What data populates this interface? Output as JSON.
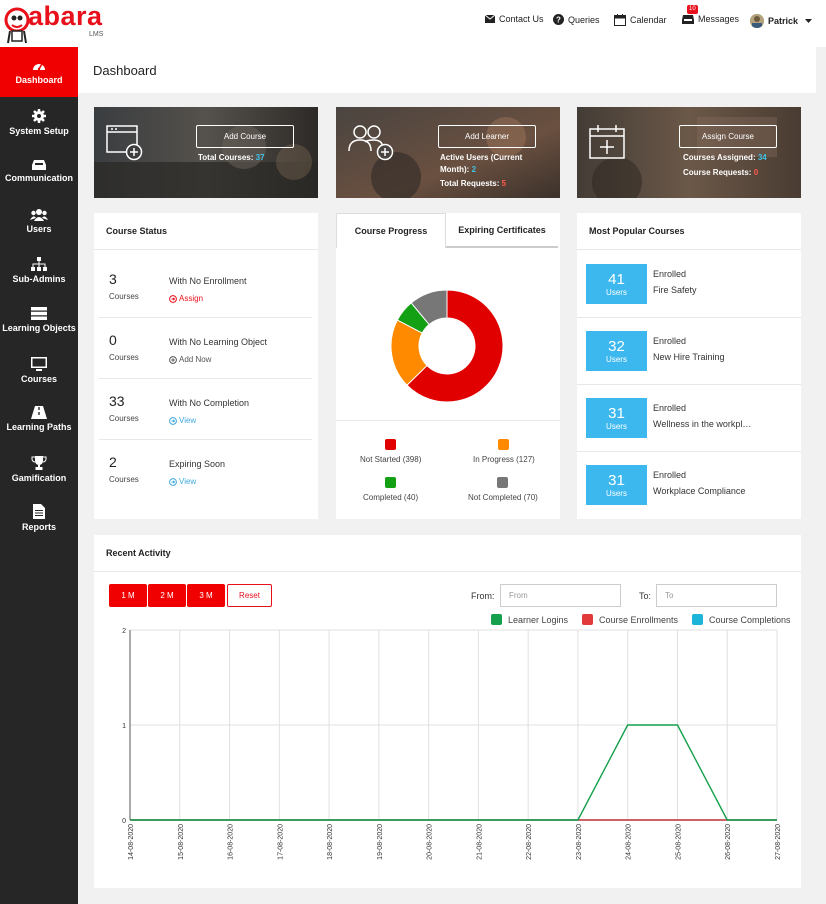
{
  "brand": {
    "name": "abara",
    "sub": "LMS"
  },
  "topnav": {
    "contact": "Contact Us",
    "queries": "Queries",
    "calendar": "Calendar",
    "messages": "Messages",
    "messages_count": "10",
    "user": "Patrick"
  },
  "sidebar": {
    "items": [
      {
        "label": "Dashboard",
        "icon": "dashboard-icon"
      },
      {
        "label": "System Setup",
        "icon": "gear-icon"
      },
      {
        "label": "Communication",
        "icon": "inbox-icon"
      },
      {
        "label": "Users",
        "icon": "users-icon"
      },
      {
        "label": "Sub-Admins",
        "icon": "sitemap-icon"
      },
      {
        "label": "Learning Objects",
        "icon": "server-icon"
      },
      {
        "label": "Courses",
        "icon": "monitor-icon"
      },
      {
        "label": "Learning Paths",
        "icon": "road-icon"
      },
      {
        "label": "Gamification",
        "icon": "trophy-icon"
      },
      {
        "label": "Reports",
        "icon": "file-icon"
      }
    ]
  },
  "page": {
    "title": "Dashboard"
  },
  "hero": {
    "course": {
      "button": "Add Course",
      "label": "Total Courses:",
      "value": "37"
    },
    "learner": {
      "button": "Add Learner",
      "label1a": "Active Users (Current",
      "label1b": "Month):",
      "value1": "2",
      "label2": "Total Requests:",
      "value2": "5"
    },
    "assign": {
      "button": "Assign Course",
      "label1": "Courses Assigned:",
      "value1": "34",
      "label2": "Course Requests:",
      "value2": "0"
    }
  },
  "course_status": {
    "title": "Course Status",
    "rows": [
      {
        "num": "3",
        "unit": "Courses",
        "label": "With No Enrollment",
        "action": "Assign",
        "action_color": "#e8101a"
      },
      {
        "num": "0",
        "unit": "Courses",
        "label": "With No Learning Object",
        "action": "Add Now",
        "action_color": "#555555"
      },
      {
        "num": "33",
        "unit": "Courses",
        "label": "With No Completion",
        "action": "View",
        "action_color": "#3fa9e0"
      },
      {
        "num": "2",
        "unit": "Courses",
        "label": "Expiring Soon",
        "action": "View",
        "action_color": "#3fa9e0"
      }
    ]
  },
  "progress": {
    "tabs": [
      "Course Progress",
      "Expiring Certificates"
    ],
    "legend": [
      {
        "label": "Not Started (398)",
        "color": "#e00000"
      },
      {
        "label": "In Progress (127)",
        "color": "#ff8a00"
      },
      {
        "label": "Completed (40)",
        "color": "#14a014"
      },
      {
        "label": "Not Completed (70)",
        "color": "#777777"
      }
    ],
    "values": [
      398,
      127,
      40,
      70
    ]
  },
  "popular": {
    "title": "Most Popular Courses",
    "rows": [
      {
        "num": "41",
        "unit": "Users",
        "status": "Enrolled",
        "course": "Fire Safety"
      },
      {
        "num": "32",
        "unit": "Users",
        "status": "Enrolled",
        "course": "New Hire Training"
      },
      {
        "num": "31",
        "unit": "Users",
        "status": "Enrolled",
        "course": "Wellness in the workpl…"
      },
      {
        "num": "31",
        "unit": "Users",
        "status": "Enrolled",
        "course": "Workplace Compliance"
      }
    ]
  },
  "activity": {
    "title": "Recent Activity",
    "ranges": [
      "1 M",
      "2 M",
      "3 M"
    ],
    "reset": "Reset",
    "from_label": "From:",
    "from_placeholder": "From",
    "to_label": "To:",
    "to_placeholder": "To"
  },
  "chart_data": {
    "type": "line",
    "x": [
      "14-08-2020",
      "15-08-2020",
      "16-08-2020",
      "17-08-2020",
      "18-08-2020",
      "19-08-2020",
      "20-08-2020",
      "21-08-2020",
      "22-08-2020",
      "23-08-2020",
      "24-08-2020",
      "25-08-2020",
      "26-08-2020",
      "27-08-2020"
    ],
    "series": [
      {
        "name": "Learner Logins",
        "color": "#14a04c",
        "values": [
          0,
          0,
          0,
          0,
          0,
          0,
          0,
          0,
          0,
          0,
          1,
          1,
          0,
          0
        ]
      },
      {
        "name": "Course Enrollments",
        "color": "#e23a3a",
        "values": [
          0,
          0,
          0,
          0,
          0,
          0,
          0,
          0,
          0,
          0,
          0,
          0,
          0,
          0
        ]
      },
      {
        "name": "Course Completions",
        "color": "#1cb4d8",
        "values": [
          0,
          0,
          0,
          0,
          0,
          0,
          0,
          0,
          0,
          0,
          0,
          0,
          0,
          0
        ]
      }
    ],
    "yticks": [
      "0",
      "1",
      "2"
    ],
    "ylim": [
      0,
      2
    ],
    "grid": true,
    "legend": "top-right"
  }
}
